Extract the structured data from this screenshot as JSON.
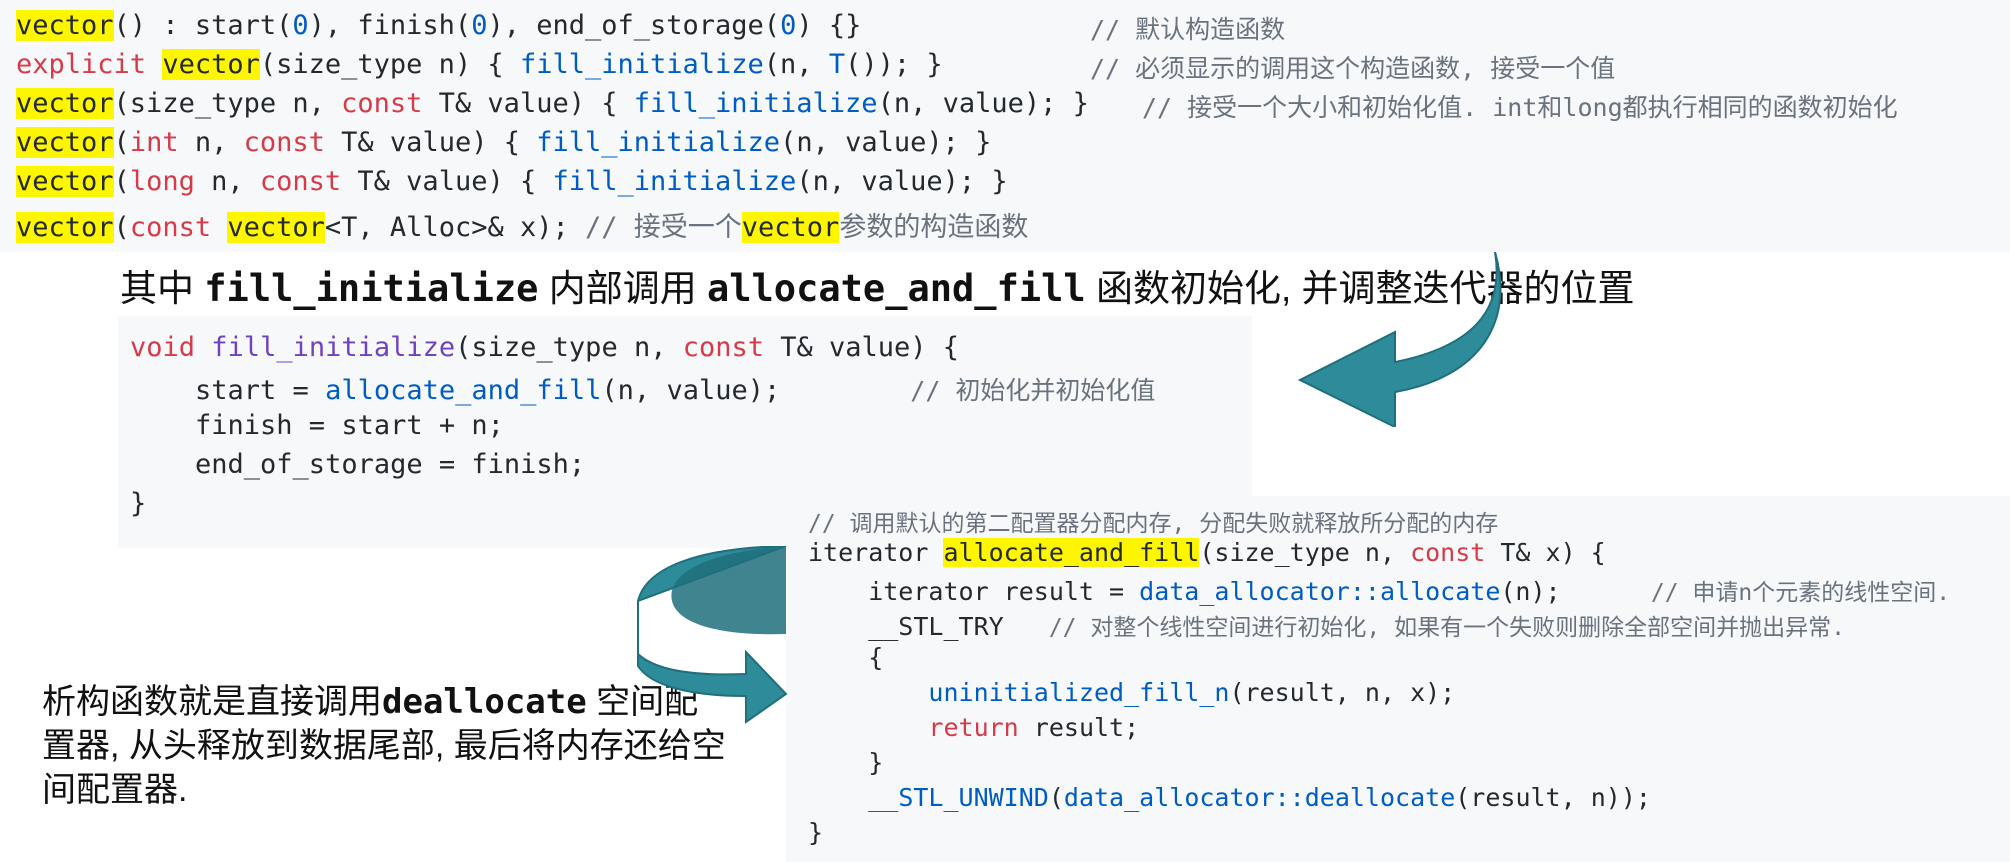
{
  "top_code": {
    "line1": {
      "a": "vector",
      "b": "() : start(",
      "c": "0",
      "d": "), finish(",
      "e": "0",
      "f": "), end_of_storage(",
      "g": "0",
      "h": ") {}",
      "cm": "// 默认构造函数"
    },
    "line2": {
      "kw": "explicit",
      "sp": " ",
      "a": "vector",
      "b": "(size_type n) { ",
      "fn": "fill_initialize",
      "c": "(n, ",
      "t": "T",
      "d": "()); }",
      "cm": "// 必须显示的调用这个构造函数, 接受一个值"
    },
    "line3": {
      "a": "vector",
      "b": "(size_type n, ",
      "kw": "const",
      "c": " T& value) { ",
      "fn": "fill_initialize",
      "d": "(n, value); }",
      "cm": "// 接受一个大小和初始化值. int和long都执行相同的函数初始化"
    },
    "line4": {
      "a": "vector",
      "b": "(",
      "kw": "int",
      "c": " n, ",
      "kw2": "const",
      "d": " T& value) { ",
      "fn": "fill_initialize",
      "e": "(n, value); }"
    },
    "line5": {
      "a": "vector",
      "b": "(",
      "kw": "long",
      "c": " n, ",
      "kw2": "const",
      "d": " T& value) { ",
      "fn": "fill_initialize",
      "e": "(n, value); }"
    },
    "line6": {
      "a": "vector",
      "b": "(",
      "kw": "const",
      "sp": " ",
      "hl": "vector",
      "c": "<T, Alloc>& x); ",
      "cm1": "// 接受一个",
      "cmhl": "vector",
      "cm2": "参数的构造函数"
    }
  },
  "caption": {
    "pre": "其中 ",
    "func1": "fill_initialize",
    "mid": " 内部调用 ",
    "func2": "allocate_and_fill",
    "post": " 函数初始化, 并调整迭代器的位置"
  },
  "fill_code": {
    "line1": {
      "kw": "void",
      "sp": " ",
      "fn": "fill_initialize",
      "a": "(size_type n, ",
      "kw2": "const",
      "b": " T& value) {"
    },
    "line2": {
      "a": "    start = ",
      "fn": "allocate_and_fill",
      "b": "(n, value);        ",
      "cm": "// 初始化并初始化值"
    },
    "line3": "    finish = start + n;",
    "line4": "    end_of_storage = finish;",
    "line5": "}"
  },
  "alloc_code": {
    "line1": "// 调用默认的第二配置器分配内存, 分配失败就释放所分配的内存",
    "line2": {
      "a": "iterator ",
      "hl": "allocate_and_fill",
      "b": "(size_type n, ",
      "kw": "const",
      "c": " T& x) {"
    },
    "line3": {
      "a": "    iterator result = ",
      "fn": "data_allocator::allocate",
      "b": "(n);      ",
      "cm": "// 申请n个元素的线性空间."
    },
    "line4": {
      "a": "    __STL_TRY   ",
      "cm": "// 对整个线性空间进行初始化, 如果有一个失败则删除全部空间并抛出异常."
    },
    "line5": "    {",
    "line6": {
      "a": "        ",
      "fn": "uninitialized_fill_n",
      "b": "(result, n, x);"
    },
    "line7": {
      "a": "        ",
      "kw": "return",
      "b": " result;"
    },
    "line8": "    }",
    "line9": {
      "a": "    ",
      "fn": "__STL_UNWIND",
      "b": "(",
      "fn2": "data_allocator::deallocate",
      "c": "(result, n));"
    },
    "line10": "}"
  },
  "destructor_note": {
    "l1_pre": "析构函数就是直接调用",
    "l1_bold": "deallocate",
    "l1_post": " 空间配",
    "l2": "置器, 从头释放到数据尾部, 最后将内存还给空",
    "l3": "间配置器."
  },
  "colors": {
    "arrow": "#2e8b9a",
    "arrow_dark": "#1f6f7c",
    "highlight": "#fdf600"
  }
}
